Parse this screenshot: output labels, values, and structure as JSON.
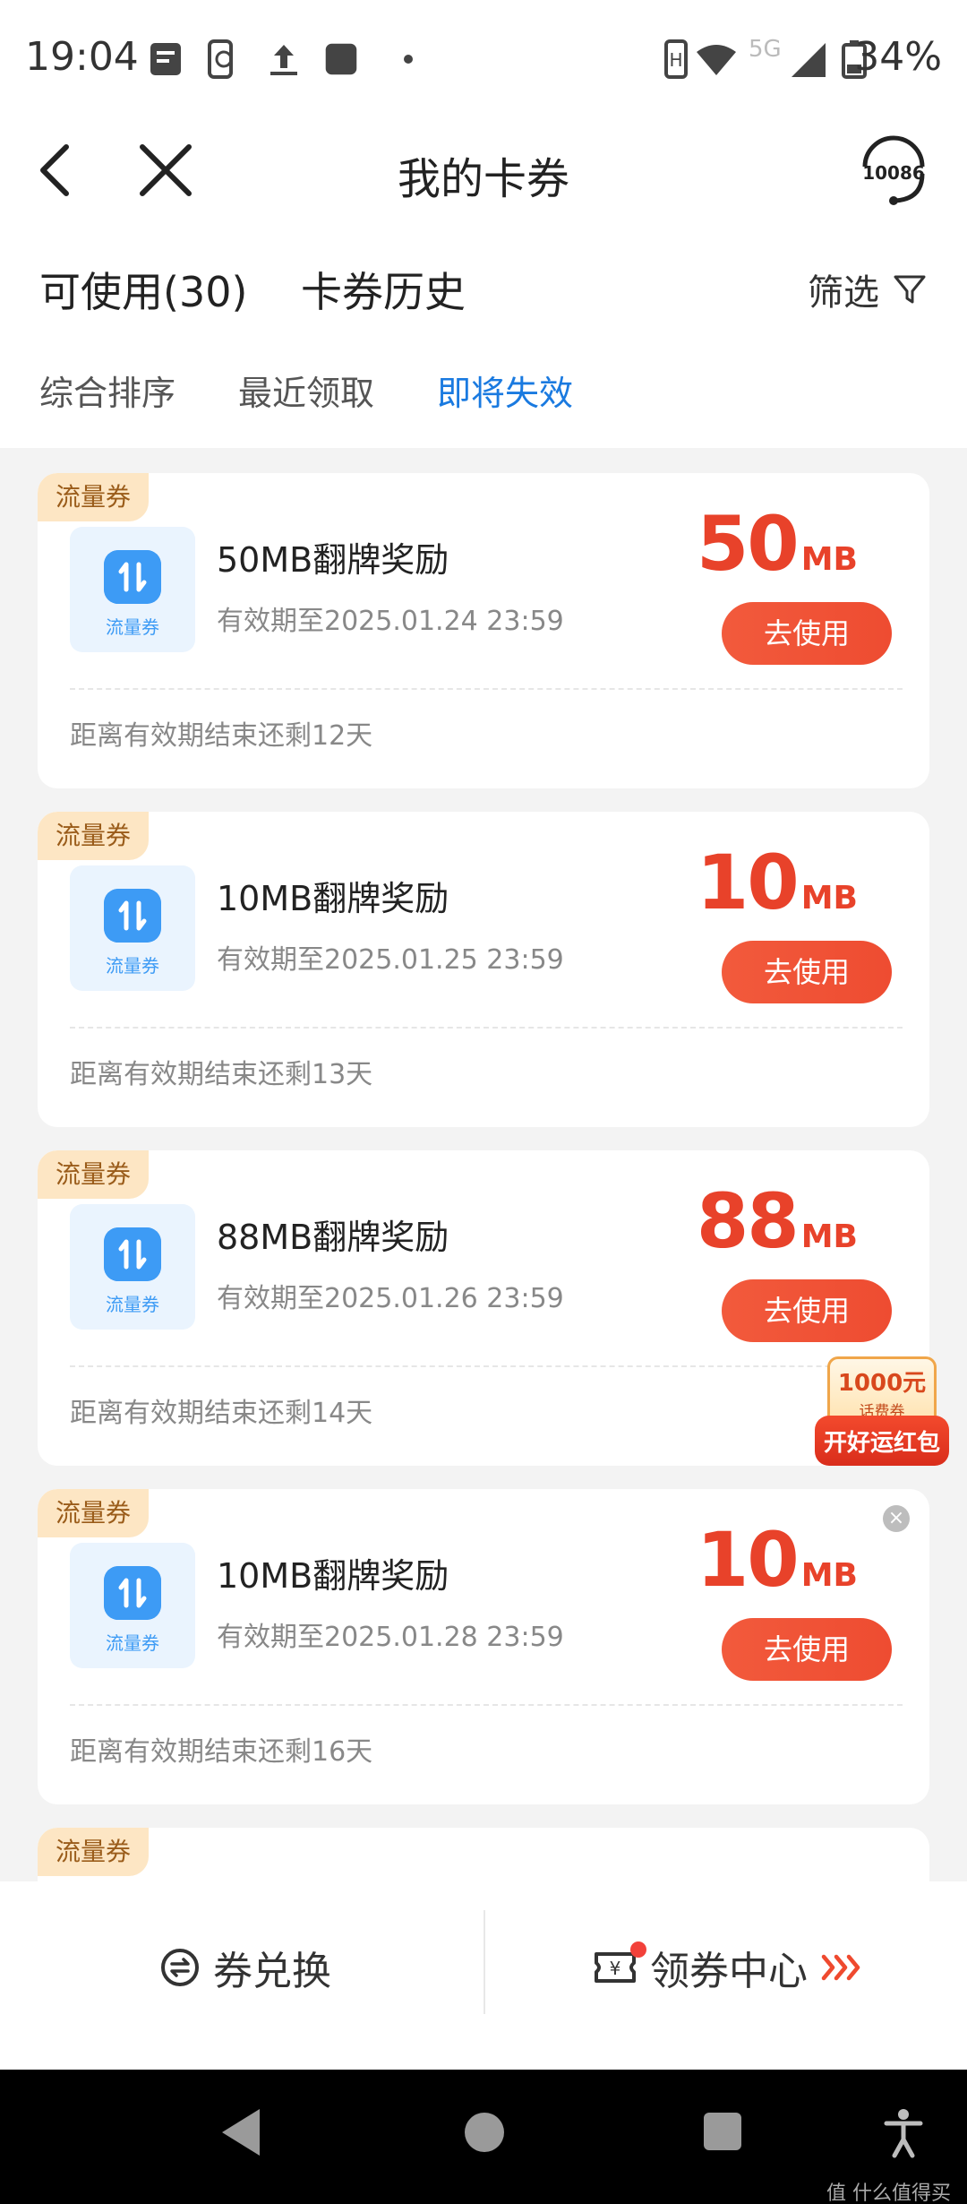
{
  "status_bar": {
    "time": "19:04",
    "network": "5G",
    "battery": "34%"
  },
  "header": {
    "title": "我的卡券",
    "service_label": "10086"
  },
  "tabs": {
    "available": "可使用(30)",
    "history": "卡券历史",
    "filter": "筛选"
  },
  "sort": [
    "综合排序",
    "最近领取",
    "即将失效"
  ],
  "accent_color": "#1a7ae0",
  "price_color": "#e8422a",
  "coupons": [
    {
      "tag": "流量券",
      "thumb_label": "流量券",
      "title": "50MB翻牌奖励",
      "expiry": "有效期至2025.01.24 23:59",
      "amount": "50",
      "unit": "MB",
      "button": "去使用",
      "remaining": "距离有效期结束还剩12天"
    },
    {
      "tag": "流量券",
      "thumb_label": "流量券",
      "title": "10MB翻牌奖励",
      "expiry": "有效期至2025.01.25 23:59",
      "amount": "10",
      "unit": "MB",
      "button": "去使用",
      "remaining": "距离有效期结束还剩13天"
    },
    {
      "tag": "流量券",
      "thumb_label": "流量券",
      "title": "88MB翻牌奖励",
      "expiry": "有效期至2025.01.26 23:59",
      "amount": "88",
      "unit": "MB",
      "button": "去使用",
      "remaining": "距离有效期结束还剩14天"
    },
    {
      "tag": "流量券",
      "thumb_label": "流量券",
      "title": "10MB翻牌奖励",
      "expiry": "有效期至2025.01.28 23:59",
      "amount": "10",
      "unit": "MB",
      "button": "去使用",
      "remaining": "距离有效期结束还剩16天"
    },
    {
      "tag": "流量券"
    }
  ],
  "float_promo": {
    "amount": "1000元",
    "sub": "话费券",
    "label": "开好运红包"
  },
  "bottom_actions": {
    "exchange": "券兑换",
    "center": "领券中心"
  },
  "watermark": "值 什么值得买"
}
